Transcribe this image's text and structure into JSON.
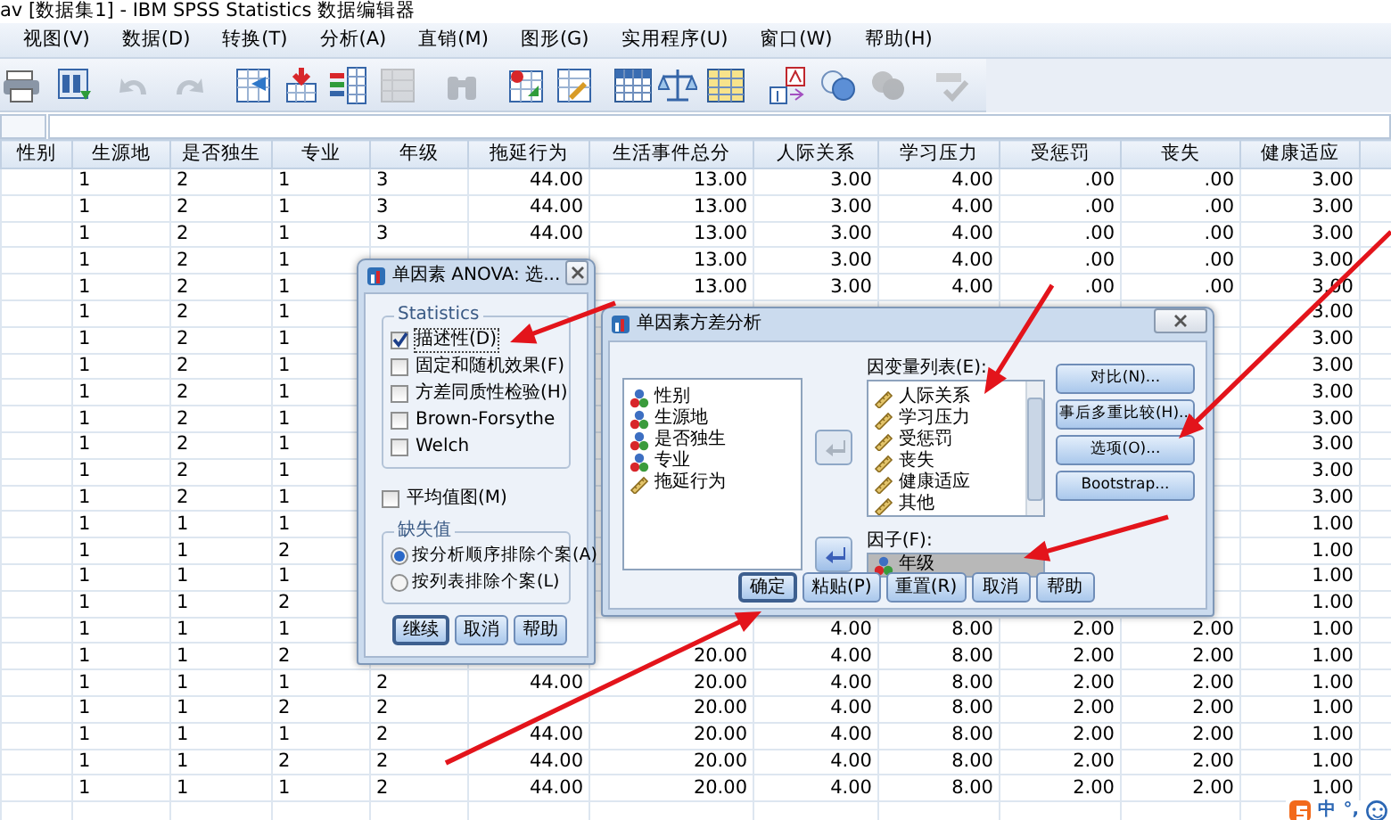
{
  "window": {
    "title": "av [数据集1] - IBM SPSS Statistics 数据编辑器"
  },
  "menu": [
    "视图(V)",
    "数据(D)",
    "转换(T)",
    "分析(A)",
    "直销(M)",
    "图形(G)",
    "实用程序(U)",
    "窗口(W)",
    "帮助(H)"
  ],
  "toolbar": [
    {
      "kind": "print",
      "disabled": false
    },
    {
      "kind": "recall",
      "disabled": false
    },
    {
      "kind": "undo",
      "disabled": true
    },
    {
      "kind": "redo",
      "disabled": true
    },
    {
      "kind": "goto-case",
      "disabled": false
    },
    {
      "kind": "goto-variable",
      "disabled": false
    },
    {
      "kind": "variables",
      "disabled": false
    },
    {
      "kind": "chart",
      "disabled": true
    },
    {
      "kind": "find",
      "disabled": true
    },
    {
      "kind": "insert-cases",
      "disabled": false
    },
    {
      "kind": "insert-variable",
      "disabled": false
    },
    {
      "kind": "split",
      "disabled": false
    },
    {
      "kind": "weight",
      "disabled": false
    },
    {
      "kind": "select",
      "disabled": false
    },
    {
      "kind": "labels",
      "disabled": false
    },
    {
      "kind": "sets",
      "disabled": false
    },
    {
      "kind": "show-all",
      "disabled": true
    },
    {
      "kind": "spell",
      "disabled": true
    }
  ],
  "grid": {
    "columns": [
      "性别",
      "生源地",
      "是否独生",
      "专业",
      "年级",
      "拖延行为",
      "生活事件总分",
      "人际关系",
      "学习压力",
      "受惩罚",
      "丧失",
      "健康适应"
    ],
    "rows": [
      [
        null,
        "1",
        "2",
        "1",
        "3",
        "44.00",
        "13.00",
        "3.00",
        "4.00",
        ".00",
        ".00",
        "3.00"
      ],
      [
        null,
        "1",
        "2",
        "1",
        "3",
        "44.00",
        "13.00",
        "3.00",
        "4.00",
        ".00",
        ".00",
        "3.00"
      ],
      [
        null,
        "1",
        "2",
        "1",
        "3",
        "44.00",
        "13.00",
        "3.00",
        "4.00",
        ".00",
        ".00",
        "3.00"
      ],
      [
        null,
        "1",
        "2",
        "1",
        null,
        null,
        "13.00",
        "3.00",
        "4.00",
        ".00",
        ".00",
        "3.00"
      ],
      [
        null,
        "1",
        "2",
        "1",
        null,
        null,
        "13.00",
        "3.00",
        "4.00",
        ".00",
        ".00",
        "3.00"
      ],
      [
        null,
        "1",
        "2",
        "1",
        null,
        null,
        null,
        null,
        null,
        null,
        null,
        "3.00"
      ],
      [
        null,
        "1",
        "2",
        "1",
        null,
        null,
        null,
        null,
        null,
        null,
        null,
        "3.00"
      ],
      [
        null,
        "1",
        "2",
        "1",
        null,
        null,
        null,
        null,
        null,
        null,
        null,
        "3.00"
      ],
      [
        null,
        "1",
        "2",
        "1",
        null,
        null,
        null,
        null,
        null,
        null,
        null,
        "3.00"
      ],
      [
        null,
        "1",
        "2",
        "1",
        null,
        null,
        null,
        null,
        null,
        null,
        null,
        "3.00"
      ],
      [
        null,
        "1",
        "2",
        "1",
        null,
        null,
        null,
        null,
        null,
        null,
        null,
        "3.00"
      ],
      [
        null,
        "1",
        "2",
        "1",
        null,
        null,
        null,
        null,
        null,
        null,
        null,
        "3.00"
      ],
      [
        null,
        "1",
        "2",
        "1",
        null,
        null,
        null,
        null,
        null,
        null,
        null,
        "3.00"
      ],
      [
        null,
        "1",
        "1",
        "1",
        null,
        null,
        null,
        null,
        null,
        null,
        null,
        "1.00"
      ],
      [
        null,
        "1",
        "1",
        "2",
        null,
        null,
        null,
        null,
        null,
        null,
        null,
        "1.00"
      ],
      [
        null,
        "1",
        "1",
        "1",
        null,
        null,
        null,
        null,
        null,
        null,
        null,
        "1.00"
      ],
      [
        null,
        "1",
        "1",
        "2",
        null,
        null,
        null,
        null,
        null,
        null,
        null,
        "1.00"
      ],
      [
        null,
        "1",
        "1",
        "1",
        null,
        null,
        null,
        "4.00",
        "8.00",
        "2.00",
        "2.00",
        "1.00"
      ],
      [
        null,
        "1",
        "1",
        "2",
        null,
        null,
        "20.00",
        "4.00",
        "8.00",
        "2.00",
        "2.00",
        "1.00"
      ],
      [
        null,
        "1",
        "1",
        "1",
        "2",
        "44.00",
        "20.00",
        "4.00",
        "8.00",
        "2.00",
        "2.00",
        "1.00"
      ],
      [
        null,
        "1",
        "1",
        "2",
        "2",
        null,
        "20.00",
        "4.00",
        "8.00",
        "2.00",
        "2.00",
        "1.00"
      ],
      [
        null,
        "1",
        "1",
        "1",
        "2",
        "44.00",
        "20.00",
        "4.00",
        "8.00",
        "2.00",
        "2.00",
        "1.00"
      ],
      [
        null,
        "1",
        "1",
        "2",
        "2",
        "44.00",
        "20.00",
        "4.00",
        "8.00",
        "2.00",
        "2.00",
        "1.00"
      ],
      [
        null,
        "1",
        "1",
        "1",
        "2",
        "44.00",
        "20.00",
        "4.00",
        "8.00",
        "2.00",
        "2.00",
        "1.00"
      ]
    ]
  },
  "options_dialog": {
    "title": "单因素 ANOVA: 选...",
    "statistics": {
      "label": "Statistics",
      "items": [
        {
          "label": "描述性(D)",
          "checked": true
        },
        {
          "label": "固定和随机效果(F)",
          "checked": false
        },
        {
          "label": "方差同质性检验(H)",
          "checked": false
        },
        {
          "label": "Brown-Forsythe",
          "checked": false
        },
        {
          "label": "Welch",
          "checked": false
        }
      ]
    },
    "means_plot": {
      "label": "平均值图(M)",
      "checked": false
    },
    "missing": {
      "label": "缺失值",
      "options": [
        {
          "label": "按分析顺序排除个案(A)",
          "selected": true
        },
        {
          "label": "按列表排除个案(L)",
          "selected": false
        }
      ]
    },
    "buttons": [
      {
        "label": "继续",
        "default": true
      },
      {
        "label": "取消",
        "default": false
      },
      {
        "label": "帮助",
        "default": false
      }
    ]
  },
  "anova_dialog": {
    "title": "单因素方差分析",
    "variables": [
      {
        "name": "性别",
        "kind": "nominal"
      },
      {
        "name": "生源地",
        "kind": "nominal"
      },
      {
        "name": "是否独生",
        "kind": "nominal"
      },
      {
        "name": "专业",
        "kind": "nominal"
      },
      {
        "name": "拖延行为",
        "kind": "scale"
      }
    ],
    "move_buttons": [
      {
        "disabled": true
      },
      {
        "disabled": false
      }
    ],
    "dependent": {
      "label": "因变量列表(E):",
      "items": [
        {
          "name": "人际关系",
          "kind": "scale"
        },
        {
          "name": "学习压力",
          "kind": "scale"
        },
        {
          "name": "受惩罚",
          "kind": "scale"
        },
        {
          "name": "丧失",
          "kind": "scale"
        },
        {
          "name": "健康适应",
          "kind": "scale"
        },
        {
          "name": "其他",
          "kind": "scale"
        }
      ]
    },
    "factor": {
      "label": "因子(F):",
      "item": {
        "name": "年级",
        "kind": "nominal"
      }
    },
    "side_buttons": [
      "对比(N)...",
      "事后多重比较(H)...",
      "选项(O)...",
      "Bootstrap..."
    ],
    "buttons": [
      {
        "label": "确定",
        "default": true
      },
      {
        "label": "粘贴(P)",
        "default": false
      },
      {
        "label": "重置(R)",
        "default": false
      },
      {
        "label": "取消",
        "default": false
      },
      {
        "label": "帮助",
        "default": false
      }
    ]
  },
  "ime": {
    "mode": "中",
    "punctuation": "°,"
  }
}
